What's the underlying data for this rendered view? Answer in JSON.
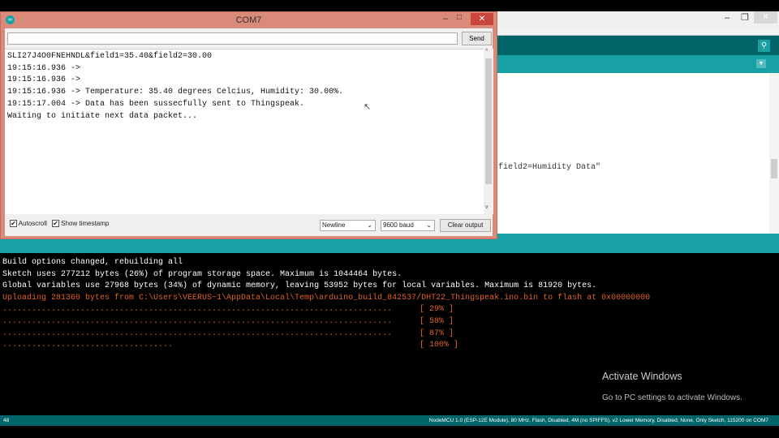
{
  "serial_monitor": {
    "title": "COM7",
    "send_label": "Send",
    "input_value": "",
    "output_lines": [
      "SLI27J4O0FNEHNDL&field1=35.40&field2=30.00",
      "19:15:16.936 ->",
      "19:15:16.936 ->",
      "19:15:16.936 -> Temperature: 35.40 degrees Celcius, Humidity: 30.00%.",
      "19:15:17.004 -> Data has been sussecfully sent to Thingspeak.",
      "Waiting to initiate next data packet..."
    ],
    "autoscroll_label": "Autoscroll",
    "autoscroll_checked": true,
    "timestamp_label": "Show timestamp",
    "timestamp_checked": true,
    "line_ending": "Newline",
    "baud": "9600 baud",
    "clear_label": "Clear output"
  },
  "editor": {
    "visible_code": "field2=Humidity Data\""
  },
  "console": {
    "lines": [
      "Build options changed, rebuilding all",
      "Sketch uses 277212 bytes (26%) of program storage space. Maximum is 1044464 bytes.",
      "Global variables use 27968 bytes (34%) of dynamic memory, leaving 53952 bytes for local variables. Maximum is 81920 bytes."
    ],
    "upload_line": "Uploading 281360 bytes from C:\\Users\\VEERUS~1\\AppData\\Local\\Temp\\arduino_build_842537/DHT22_Thingspeak.ino.bin to flash at 0x00000000",
    "progress": [
      {
        "dots": "................................................................................",
        "pct": "[ 29% ]"
      },
      {
        "dots": "................................................................................",
        "pct": "[ 58% ]"
      },
      {
        "dots": "................................................................................",
        "pct": "[ 87% ]"
      },
      {
        "dots": "...................................",
        "pct": "[ 100% ]"
      }
    ],
    "error_color": "#e0622a"
  },
  "status": {
    "line": "48",
    "board": "NodeMCU 1.0 (ESP-12E Module), 80 MHz, Flash, Disabled, 4M (no SPIFFS), v2 Lower Memory, Disabled, None, Only Sketch, 115200 on COM7"
  },
  "watermark": {
    "title": "Activate Windows",
    "subtitle": "Go to PC settings to activate Windows."
  }
}
